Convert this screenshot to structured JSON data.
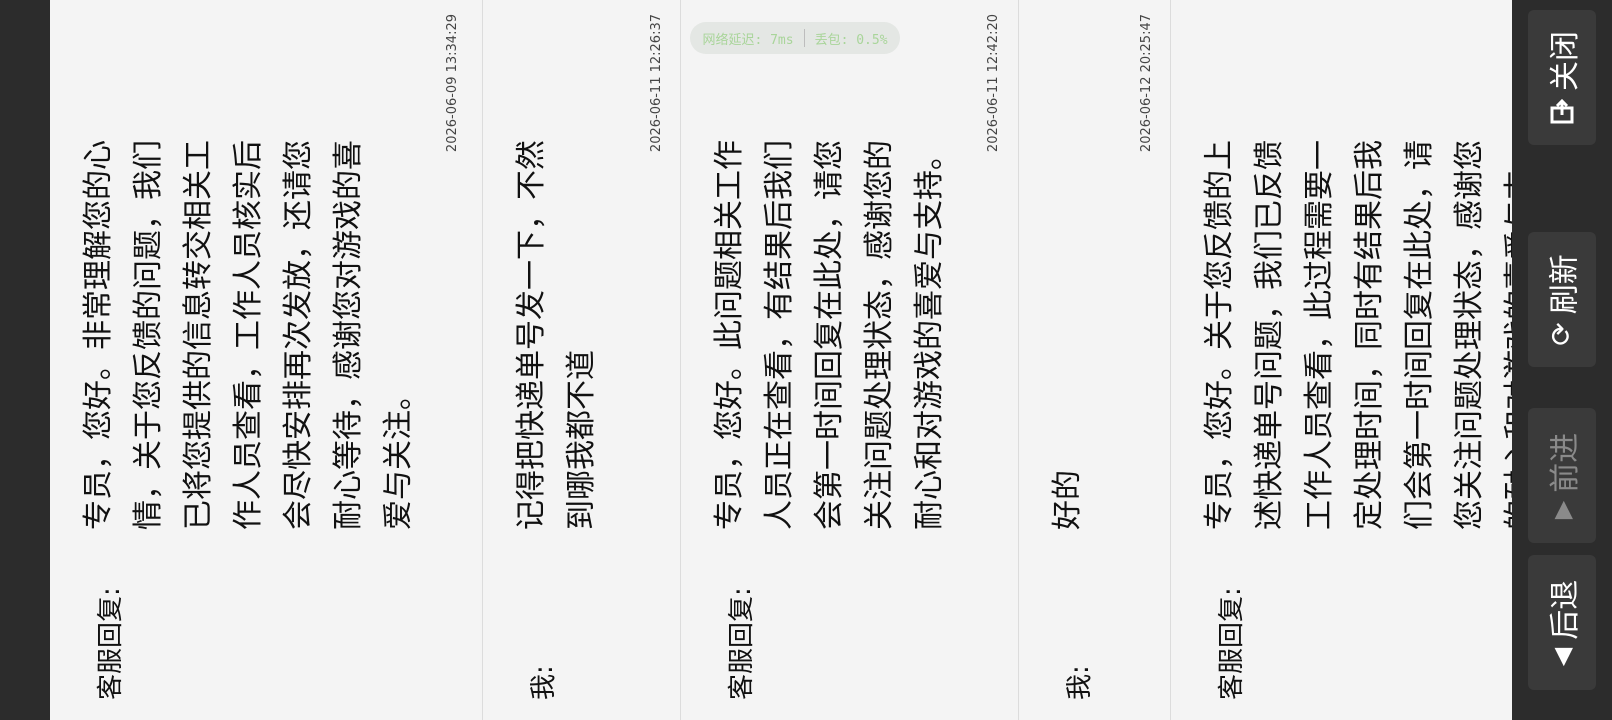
{
  "status": {
    "ping": "网络延迟: 7ms",
    "loss": "丢包: 0.5%"
  },
  "messages": [
    {
      "sender": "客服回复:",
      "text": "专员，您好。非常理解您的心情，关于您反馈的问题，我们已将您提供的信息转交相关工作人员查看，工作人员核实后会尽快安排再次发放，还请您耐心等待，感谢您对游戏的喜爱与关注。",
      "time": "2026-06-09 13:34:29"
    },
    {
      "sender": "我:",
      "text": "记得把快递单号发一下，不然到哪我都不道",
      "time": "2026-06-11 12:26:37"
    },
    {
      "sender": "客服回复:",
      "text": "专员，您好。此问题相关工作人员正在查看，有结果后我们会第一时间回复在此处，请您关注问题处理状态，感谢您的耐心和对游戏的喜爱与支持。",
      "time": "2026-06-11 12:42:20"
    },
    {
      "sender": "我:",
      "text": "好的",
      "time": "2026-06-12 20:25:47"
    },
    {
      "sender": "客服回复:",
      "text": "专员，您好。关于您反馈的上述快递单号问题，我们已反馈工作人员查看，此过程需要一定处理时间，同时有结果后我们会第一时间回复在此处，请您关注问题处理状态，感谢您的耐心和对游戏的喜爱与支持。",
      "time": ""
    }
  ],
  "toolbar": {
    "close": "关闭",
    "refresh": "刷新",
    "forward": "前进",
    "back": "后退",
    "icons": {
      "close": "exit-icon",
      "refresh": "refresh-icon",
      "forward": "play-right-icon",
      "back": "play-left-icon"
    }
  }
}
